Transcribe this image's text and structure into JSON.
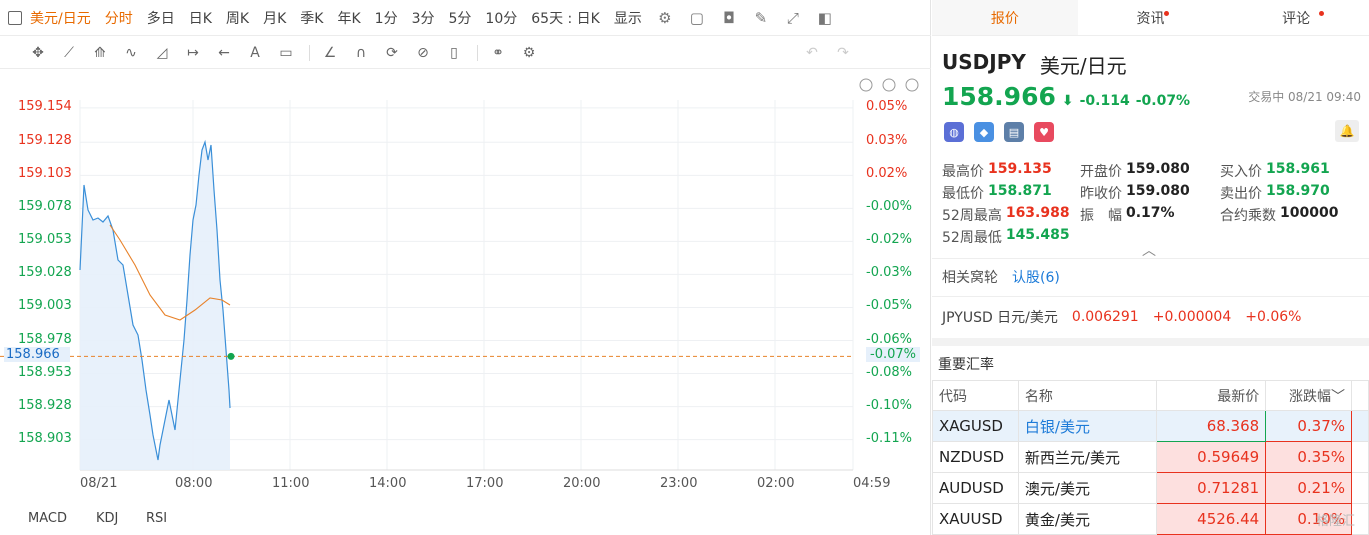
{
  "toolbar": {
    "pair": "美元/日元",
    "periods": [
      "分时",
      "多日",
      "日K",
      "周K",
      "月K",
      "季K",
      "年K",
      "1分",
      "3分",
      "5分",
      "10分"
    ],
    "active_period": "分时",
    "range": "65天 : 日K",
    "display": "显示"
  },
  "chart": {
    "y_left": [
      "159.154",
      "159.128",
      "159.103",
      "159.078",
      "159.053",
      "159.028",
      "159.003",
      "158.978",
      "158.966",
      "158.953",
      "158.928",
      "158.903"
    ],
    "y_right": [
      "0.05%",
      "0.03%",
      "0.02%",
      "-0.00%",
      "-0.02%",
      "-0.03%",
      "-0.05%",
      "-0.06%",
      "-0.07%",
      "-0.08%",
      "-0.10%",
      "-0.11%"
    ],
    "x": [
      "08/21",
      "08:00",
      "11:00",
      "14:00",
      "17:00",
      "20:00",
      "23:00",
      "02:00",
      "04:59"
    ],
    "indicators": [
      "MACD",
      "KDJ",
      "RSI"
    ],
    "colors": {
      "line": "#3a8fd8",
      "avg": "#e8822a",
      "up": "#e8321e",
      "down": "#13a550"
    }
  },
  "chart_data": {
    "type": "line",
    "x": [
      "08/21 05:00",
      "08/21 08:00",
      "08/21 11:00",
      "08/21 14:00",
      "08/21 17:00",
      "08/21 20:00",
      "08/21 23:00",
      "08/22 02:00",
      "08/22 04:59"
    ],
    "ylim": [
      158.88,
      159.16
    ],
    "series": [
      {
        "values": [
          159.08,
          159.06,
          158.99,
          158.92,
          158.89,
          158.94,
          159.12,
          159.01,
          158.96
        ]
      },
      {
        "values": [
          159.06,
          159.05,
          159.04,
          159.02,
          159.01,
          159.0,
          159.0,
          159.0,
          159.0
        ]
      }
    ],
    "last": "158.966",
    "last_pct": "-0.07%"
  },
  "tabs": [
    "报价",
    "资讯",
    "评论"
  ],
  "quote": {
    "symbol": "USDJPY",
    "name": "美元/日元",
    "price": "158.966",
    "arrow": "⬇",
    "change": "-0.114",
    "change_pct": "-0.07%",
    "status": "交易中 08/21 09:40",
    "stats": [
      [
        {
          "k": "最高价",
          "v": "159.135",
          "c": "red"
        },
        {
          "k": "开盘价",
          "v": "159.080",
          "c": "dark"
        },
        {
          "k": "买入价",
          "v": "158.961",
          "c": "green"
        }
      ],
      [
        {
          "k": "最低价",
          "v": "158.871",
          "c": "green"
        },
        {
          "k": "昨收价",
          "v": "159.080",
          "c": "dark"
        },
        {
          "k": "卖出价",
          "v": "158.970",
          "c": "green"
        }
      ],
      [
        {
          "k": "52周最高",
          "v": "163.988",
          "c": "red"
        },
        {
          "k": "振　幅",
          "v": "0.17%",
          "c": "dark"
        },
        {
          "k": "合约乘数",
          "v": "100000",
          "c": "dark"
        }
      ],
      [
        {
          "k": "52周最低",
          "v": "145.485",
          "c": "green"
        }
      ]
    ]
  },
  "related": {
    "label": "相关窝轮",
    "link": "认股(6)"
  },
  "jpyusd": {
    "name": "JPYUSD 日元/美元",
    "price": "0.006291",
    "chg": "+0.000004",
    "pct": "+0.06%"
  },
  "rates": {
    "title": "重要汇率",
    "headers": [
      "代码",
      "名称",
      "最新价",
      "涨跌幅"
    ],
    "rows": [
      {
        "code": "XAGUSD",
        "name": "白银/美元",
        "price": "68.368",
        "pct": "0.37%"
      },
      {
        "code": "NZDUSD",
        "name": "新西兰元/美元",
        "price": "0.59649",
        "pct": "0.35%"
      },
      {
        "code": "AUDUSD",
        "name": "澳元/美元",
        "price": "0.71281",
        "pct": "0.21%"
      },
      {
        "code": "XAUUSD",
        "name": "黄金/美元",
        "price": "4526.44",
        "pct": "0.10%"
      }
    ]
  },
  "watermark": "格隆汇"
}
